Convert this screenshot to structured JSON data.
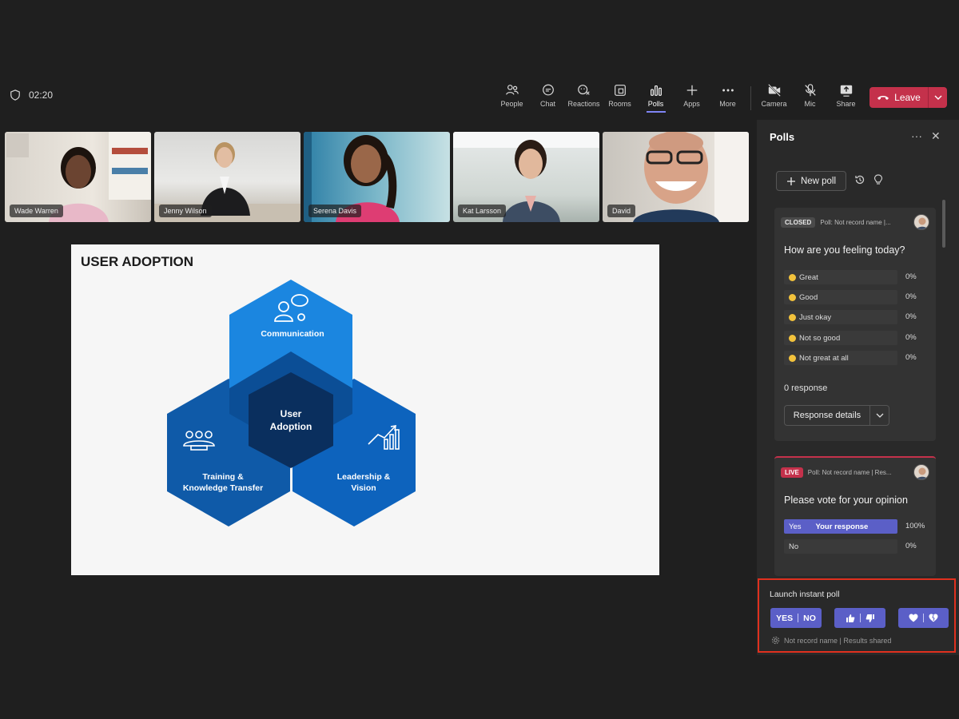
{
  "meeting": {
    "timer": "02:20"
  },
  "toolbar": {
    "items": [
      {
        "label": "People",
        "icon": "people-icon"
      },
      {
        "label": "Chat",
        "icon": "chat-icon"
      },
      {
        "label": "Reactions",
        "icon": "reactions-icon"
      },
      {
        "label": "Rooms",
        "icon": "rooms-icon"
      },
      {
        "label": "Polls",
        "icon": "polls-icon",
        "active": true
      },
      {
        "label": "Apps",
        "icon": "plus-icon"
      },
      {
        "label": "More",
        "icon": "more-icon"
      },
      {
        "label": "Camera",
        "icon": "camera-off-icon"
      },
      {
        "label": "Mic",
        "icon": "mic-off-icon"
      },
      {
        "label": "Share",
        "icon": "share-icon"
      }
    ],
    "leave_label": "Leave"
  },
  "participants": [
    "Wade Warren",
    "Jenny Wilson",
    "Serena Davis",
    "Kat Larsson",
    "David"
  ],
  "slide": {
    "title": "USER ADOPTION",
    "center": [
      "User",
      "Adoption"
    ],
    "segments": {
      "top": [
        "Communication"
      ],
      "left": [
        "Training &",
        "Knowledge Transfer"
      ],
      "right": [
        "Leadership &",
        "Vision"
      ]
    }
  },
  "polls_panel": {
    "title": "Polls",
    "new_poll_label": "New poll",
    "closed_poll": {
      "status": "CLOSED",
      "meta": "Poll: Not record name |...",
      "question": "How are you feeling today?",
      "options": [
        {
          "label": "Great",
          "percent": "0%"
        },
        {
          "label": "Good",
          "percent": "0%"
        },
        {
          "label": "Just okay",
          "percent": "0%"
        },
        {
          "label": "Not so good",
          "percent": "0%"
        },
        {
          "label": "Not great at all",
          "percent": "0%"
        }
      ],
      "responses": "0 response",
      "details_label": "Response details"
    },
    "live_poll": {
      "status": "LIVE",
      "meta": "Poll: Not record name | Res...",
      "question": "Please vote for your opinion",
      "options": [
        {
          "label": "Yes",
          "note": "Your response",
          "percent": "100%"
        },
        {
          "label": "No",
          "percent": "0%"
        }
      ]
    },
    "instant": {
      "title": "Launch instant poll",
      "yes_label": "YES",
      "no_label": "NO",
      "footer": "Not record name | Results shared"
    }
  },
  "colors": {
    "accent": "#5b5fc7",
    "leave": "#c4314b",
    "highlight": "#e0301e"
  }
}
